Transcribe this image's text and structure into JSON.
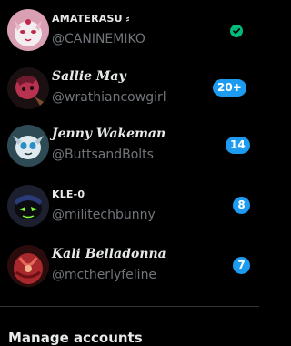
{
  "accounts": [
    {
      "display_name": "AMATERASU ⸗",
      "handle": "@CANINEMIKO",
      "status_icon": "check-circle-icon",
      "status_color": "#00ba7c"
    },
    {
      "display_name": "Sallie May",
      "handle": "@wrathiancowgirl",
      "notification_count": "20+"
    },
    {
      "display_name": "Jenny Wakeman",
      "handle": "@ButtsandBolts",
      "notification_count": "14"
    },
    {
      "display_name": "KLE-0",
      "handle": "@militechbunny",
      "notification_count": "8"
    },
    {
      "display_name": "Kali Belladonna",
      "handle": "@mctherlyfeline",
      "notification_count": "7"
    }
  ],
  "footer": {
    "manage_label": "Manage accounts"
  },
  "colors": {
    "background": "#000000",
    "badge": "#1d9bf0",
    "handle": "#71767b",
    "divider": "#2f3336"
  }
}
